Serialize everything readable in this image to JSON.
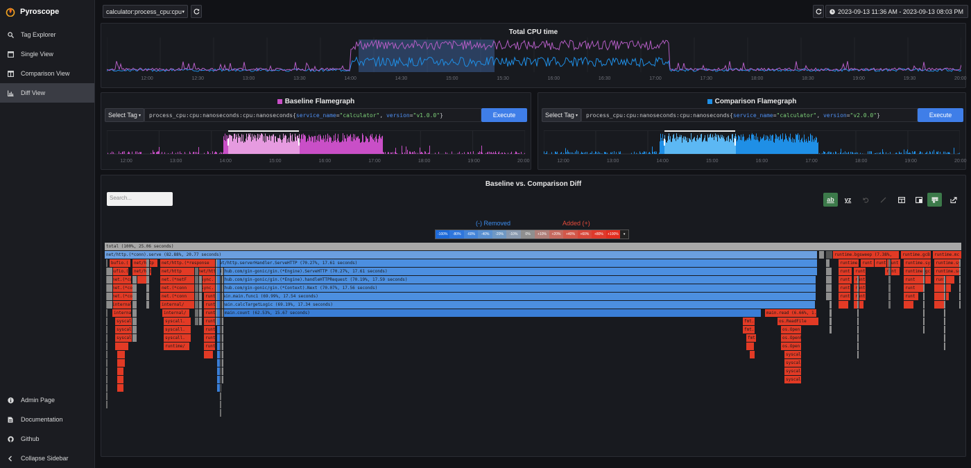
{
  "app": {
    "name": "Pyroscope"
  },
  "sidebar": {
    "items": [
      {
        "label": "Tag Explorer",
        "icon": "search-icon"
      },
      {
        "label": "Single View",
        "icon": "window-icon"
      },
      {
        "label": "Comparison View",
        "icon": "columns-icon"
      },
      {
        "label": "Diff View",
        "icon": "chart-icon"
      }
    ],
    "bottom": [
      {
        "label": "Admin Page",
        "icon": "info-icon"
      },
      {
        "label": "Documentation",
        "icon": "document-icon"
      },
      {
        "label": "Github",
        "icon": "github-icon"
      },
      {
        "label": "Collapse Sidebar",
        "icon": "chevron-left-icon"
      }
    ]
  },
  "topbar": {
    "app_selector": "calculator:process_cpu:cpu",
    "date_range": "2023-09-13 11:36 AM - 2023-09-13 08:03 PM"
  },
  "main_timeline": {
    "title": "Total CPU time",
    "ticks": [
      "12:00",
      "12:30",
      "13:00",
      "13:30",
      "14:00",
      "14:30",
      "15:00",
      "15:30",
      "16:00",
      "16:30",
      "17:00",
      "17:30",
      "18:00",
      "18:30",
      "19:00",
      "19:30",
      "20:00"
    ]
  },
  "baseline": {
    "title": "Baseline Flamegraph",
    "color": "#c94fc7",
    "select_tag": "Select Tag",
    "query_prefix": "process_cpu:cpu:nanoseconds:cpu:nanoseconds{",
    "q_key1": "service_name",
    "q_val1": "\"calculator\"",
    "q_key2": "version",
    "q_val2": "\"v1.0.0\"",
    "q_suffix": "}",
    "execute": "Execute",
    "ticks": [
      "12:00",
      "13:00",
      "14:00",
      "15:00",
      "16:00",
      "17:00",
      "18:00",
      "19:00",
      "20:00"
    ]
  },
  "comparison": {
    "title": "Comparison Flamegraph",
    "color": "#1f8fe6",
    "select_tag": "Select Tag",
    "query_prefix": "process_cpu:cpu:nanoseconds:cpu:nanoseconds{",
    "q_key1": "service_name",
    "q_val1": "\"calculator\"",
    "q_key2": "version",
    "q_val2": "\"v2.0.0\"",
    "q_suffix": "}",
    "execute": "Execute",
    "ticks": [
      "12:00",
      "13:00",
      "14:00",
      "15:00",
      "16:00",
      "17:00",
      "18:00",
      "19:00",
      "20:00"
    ]
  },
  "diff": {
    "title": "Baseline vs. Comparison Diff",
    "search_placeholder": "Search...",
    "removed_label": "(-) Removed",
    "added_label": "Added (+)",
    "legend": [
      "-100%",
      "-80%",
      "-60%",
      "-40%",
      "-20%",
      "-10%",
      "0%",
      "+10%",
      "+20%",
      "+40%",
      "+60%",
      "+80%",
      "+100%"
    ],
    "legend_caret": "▾",
    "toolbar": {
      "ab": "ab",
      "yz": "yz"
    },
    "flame_labels": {
      "total": "total (100%, 25.06 seconds)",
      "serve": "net/http.(*conn).serve (82.88%, 20.77 seconds)",
      "serveHTTP": "net/http.serverHandler.ServeHTTP (70.27%, 17.61 seconds)",
      "ginServe": "github.com/gin-gonic/gin.(*Engine).ServeHTTP (70.27%, 17.61 seconds)",
      "handleHTTP": "github.com/gin-gonic/gin.(*Engine).handleHTTPRequest (70.19%, 17.59 seconds)",
      "next": "github.com/gin-gonic/gin.(*Context).Next (70.07%, 17.56 seconds)",
      "func1": "main.main.func1 (69.99%, 17.54 seconds)",
      "calc": "main.calcTargetLogic (69.19%, 17.34 seconds)",
      "count": "main.count (62.53%, 15.67 seconds)",
      "mainRead": "main.read (6.66%, 1.6",
      "bgsweep": "runtime.bgsweep (7.38%,",
      "gcB": "runtime.gcB",
      "runtimeMc": "runtime.mc",
      "bufio1": "bufio.(",
      "nethttp1": "net/http",
      "nethttp2": "net/http.(*response",
      "netconn": "net.(*conn",
      "netconn2": "net.(*netF",
      "internal1": "internal/",
      "syscall": "syscall.",
      "runtimeSlash": "runtime/",
      "sync": "sync.",
      "run": "runt",
      "fmt": "fmt.",
      "osRead": "os.ReadFile",
      "osOpen": "os.Open",
      "osOpenF": "os.OpenF",
      "runtimeFr": "runtime.fr",
      "runtimeSy": "runtime.sy",
      "runtimeGc": "runtime.gc",
      "runtimeSc": "runtime.sc"
    }
  }
}
